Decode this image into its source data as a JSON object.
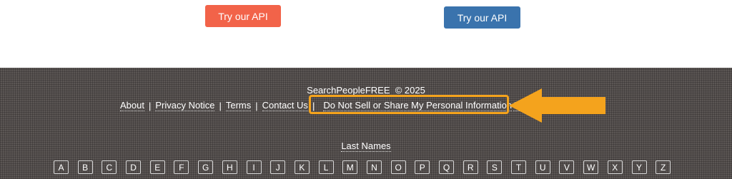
{
  "top": {
    "api_button_left": "Try our API",
    "api_button_right": "Try our API",
    "colors": {
      "left_button": "#f26349",
      "right_button": "#3a73ad"
    }
  },
  "footer": {
    "copyright": "SearchPeopleFREE  © 2025",
    "links": {
      "about": "About",
      "privacy": "Privacy Notice",
      "terms": "Terms",
      "contact": "Contact Us",
      "do_not_sell": "Do Not Sell or Share My Personal Information",
      "partial": "S"
    },
    "separator": "|",
    "last_names_label": "Last Names",
    "letters": [
      "A",
      "B",
      "C",
      "D",
      "E",
      "F",
      "G",
      "H",
      "I",
      "J",
      "K",
      "L",
      "M",
      "N",
      "O",
      "P",
      "Q",
      "R",
      "S",
      "T",
      "U",
      "V",
      "W",
      "X",
      "Y",
      "Z"
    ],
    "annotation": {
      "type": "arrow-icon",
      "color": "#f4a31d"
    }
  }
}
